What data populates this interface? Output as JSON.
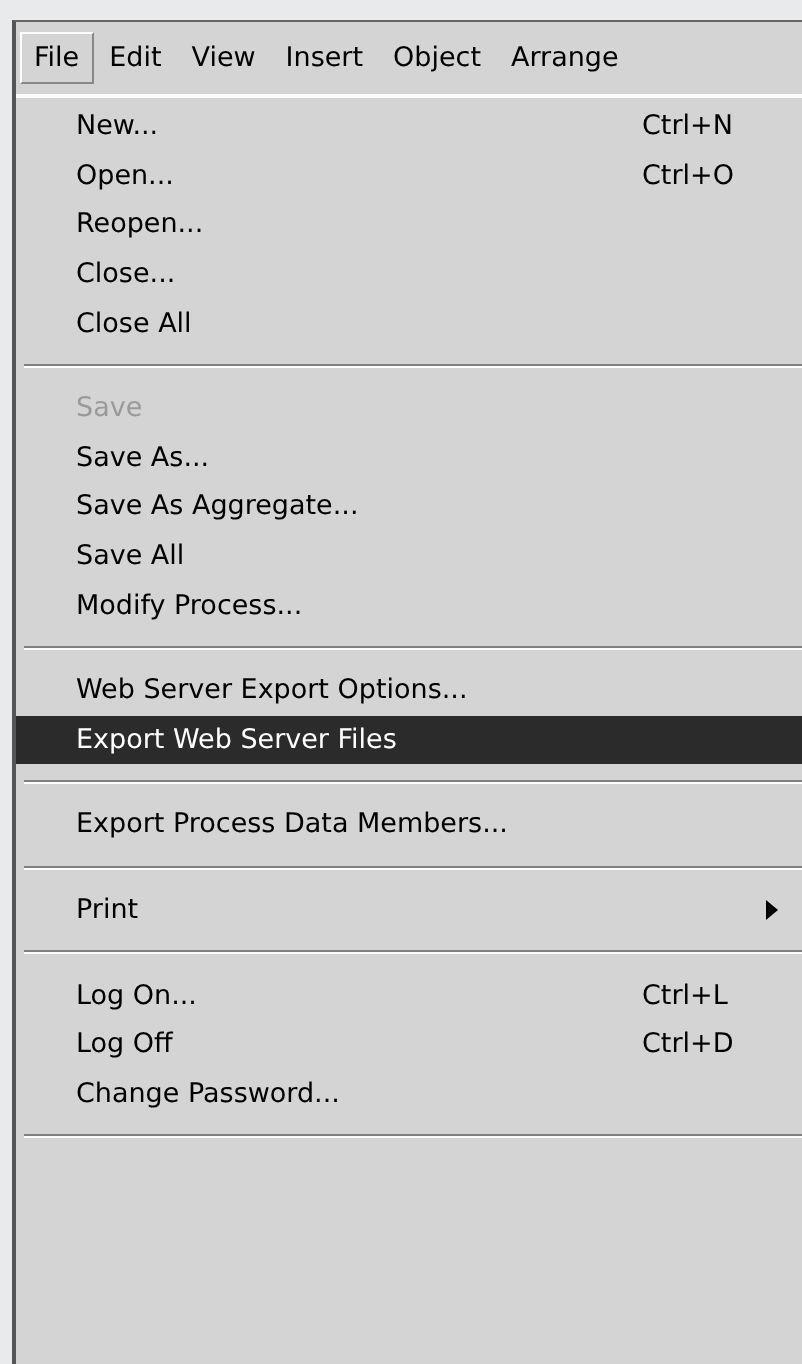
{
  "menubar": [
    {
      "label": "File",
      "selected": true
    },
    {
      "label": "Edit",
      "selected": false
    },
    {
      "label": "View",
      "selected": false
    },
    {
      "label": "Insert",
      "selected": false
    },
    {
      "label": "Object",
      "selected": false
    },
    {
      "label": "Arrange",
      "selected": false
    }
  ],
  "menu": [
    {
      "kind": "item",
      "label": "New...",
      "shortcut": "Ctrl+N",
      "disabled": false,
      "selected": false
    },
    {
      "kind": "item",
      "label": "Open...",
      "shortcut": "Ctrl+O",
      "disabled": false,
      "selected": false
    },
    {
      "kind": "item",
      "label": "Reopen...",
      "disabled": false,
      "selected": false
    },
    {
      "kind": "item",
      "label": "Close...",
      "disabled": false,
      "selected": false
    },
    {
      "kind": "item",
      "label": "Close All",
      "disabled": false,
      "selected": false
    },
    {
      "kind": "separator"
    },
    {
      "kind": "item",
      "label": "Save",
      "disabled": true,
      "selected": false
    },
    {
      "kind": "item",
      "label": "Save As...",
      "disabled": false,
      "selected": false
    },
    {
      "kind": "item",
      "label": "Save As Aggregate...",
      "disabled": false,
      "selected": false
    },
    {
      "kind": "item",
      "label": "Save All",
      "disabled": false,
      "selected": false
    },
    {
      "kind": "item",
      "label": "Modify Process...",
      "disabled": false,
      "selected": false
    },
    {
      "kind": "separator"
    },
    {
      "kind": "item",
      "label": "Web Server Export Options...",
      "disabled": false,
      "selected": false
    },
    {
      "kind": "item",
      "label": "Export Web Server Files",
      "disabled": false,
      "selected": true
    },
    {
      "kind": "separator"
    },
    {
      "kind": "item",
      "label": "Export Process Data Members...",
      "disabled": false,
      "selected": false
    },
    {
      "kind": "separator"
    },
    {
      "kind": "submenu",
      "label": "Print",
      "disabled": false,
      "selected": false
    },
    {
      "kind": "separator"
    },
    {
      "kind": "item",
      "label": "Log On...",
      "shortcut": "Ctrl+L",
      "disabled": false,
      "selected": false
    },
    {
      "kind": "item",
      "label": "Log Off",
      "shortcut": "Ctrl+D",
      "disabled": false,
      "selected": false
    },
    {
      "kind": "item",
      "label": "Change Password...",
      "disabled": false,
      "selected": false
    },
    {
      "kind": "separator"
    }
  ]
}
